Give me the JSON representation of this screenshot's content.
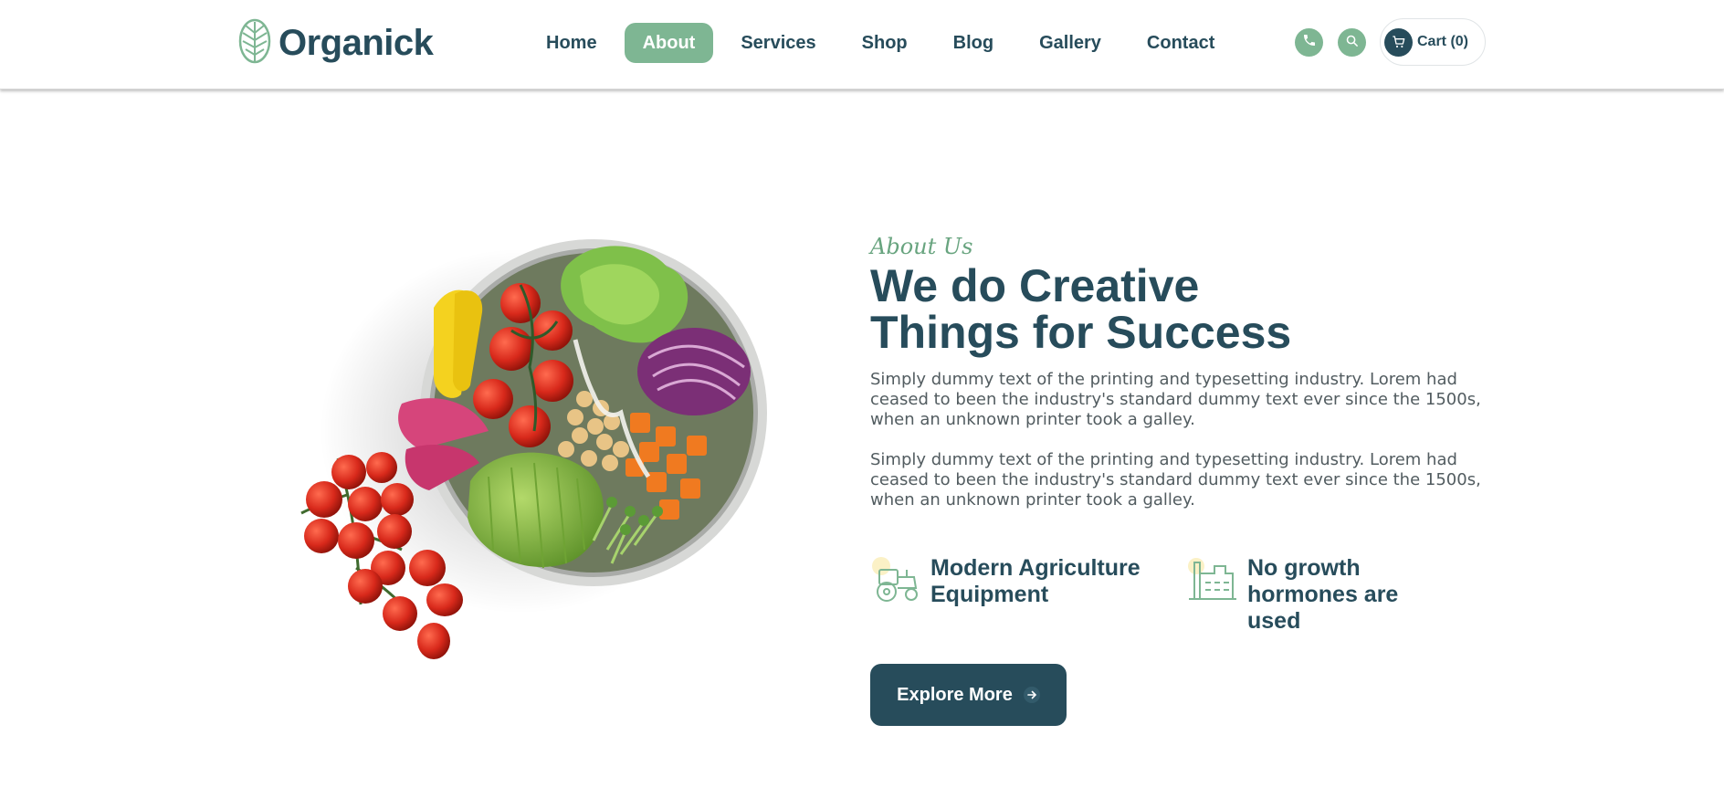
{
  "brand": {
    "name": "Organick",
    "color": "#274c5b",
    "accent": "#7eb693"
  },
  "nav": {
    "items": [
      {
        "label": "Home",
        "active": false
      },
      {
        "label": "About",
        "active": true
      },
      {
        "label": "Services",
        "active": false
      },
      {
        "label": "Shop",
        "active": false
      },
      {
        "label": "Blog",
        "active": false
      },
      {
        "label": "Gallery",
        "active": false
      },
      {
        "label": "Contact",
        "active": false
      }
    ]
  },
  "header_icons": {
    "phone": "phone-icon",
    "search": "search-icon",
    "cart": "cart-icon"
  },
  "cart": {
    "label": "Cart (0)"
  },
  "about": {
    "tag": "About Us",
    "headline_line1": "We do Creative",
    "headline_line2": "Things for Success",
    "paragraph1": "Simply dummy text of the printing and typesetting industry. Lorem had ceased to been the industry's standard dummy text ever since the 1500s, when an unknown printer took a galley.",
    "paragraph2": "Simply dummy text of the printing and typesetting industry. Lorem had ceased to been the industry's standard dummy text ever since the 1500s, when an unknown printer took a galley.",
    "features": [
      {
        "icon": "tractor-icon",
        "line1": "Modern Agriculture",
        "line2": "Equipment"
      },
      {
        "icon": "factory-icon",
        "line1": "No growth",
        "line2": "hormones are used"
      }
    ],
    "button_label": "Explore More"
  }
}
